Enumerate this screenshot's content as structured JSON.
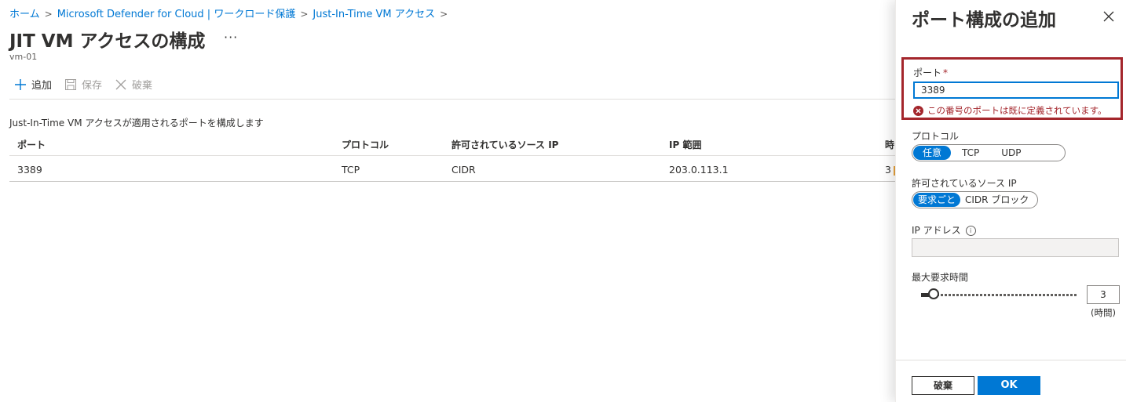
{
  "breadcrumb": [
    {
      "label": "ホーム"
    },
    {
      "label": "Microsoft Defender for Cloud | ワークロード保護"
    },
    {
      "label": "Just-In-Time VM アクセス"
    }
  ],
  "page": {
    "title": "JIT VM アクセスの構成",
    "more": "···",
    "subtitle": "vm-01"
  },
  "toolbar": {
    "add_label": "追加",
    "save_label": "保存",
    "discard_label": "破棄"
  },
  "description": "Just-In-Time VM アクセスが適用されるポートを構成します",
  "table": {
    "headers": [
      "ポート",
      "プロトコル",
      "許可されているソース IP",
      "IP 範囲",
      "時"
    ],
    "rows": [
      [
        "3389",
        "TCP",
        "CIDR",
        "203.0.113.1",
        "3"
      ]
    ]
  },
  "panel": {
    "title": "ポート構成の追加",
    "port_label": "ポート",
    "required_mark": "*",
    "port_value": "3389",
    "error_text": "この番号のポートは既に定義されています。",
    "protocol_label": "プロトコル",
    "protocol_options": [
      "任意",
      "TCP",
      "UDP"
    ],
    "protocol_selected": "任意",
    "source_ip_label": "許可されているソース IP",
    "source_ip_options": [
      "要求ごと",
      "CIDR ブロック"
    ],
    "source_ip_selected": "要求ごと",
    "ip_address_label": "IP アドレス",
    "ip_address_value": "",
    "max_time_label": "最大要求時間",
    "max_time_value": "3",
    "max_time_unit": "(時間)",
    "discard_button": "破棄",
    "ok_button": "OK"
  },
  "colors": {
    "accent": "#0078d4",
    "error": "#a4262c"
  }
}
